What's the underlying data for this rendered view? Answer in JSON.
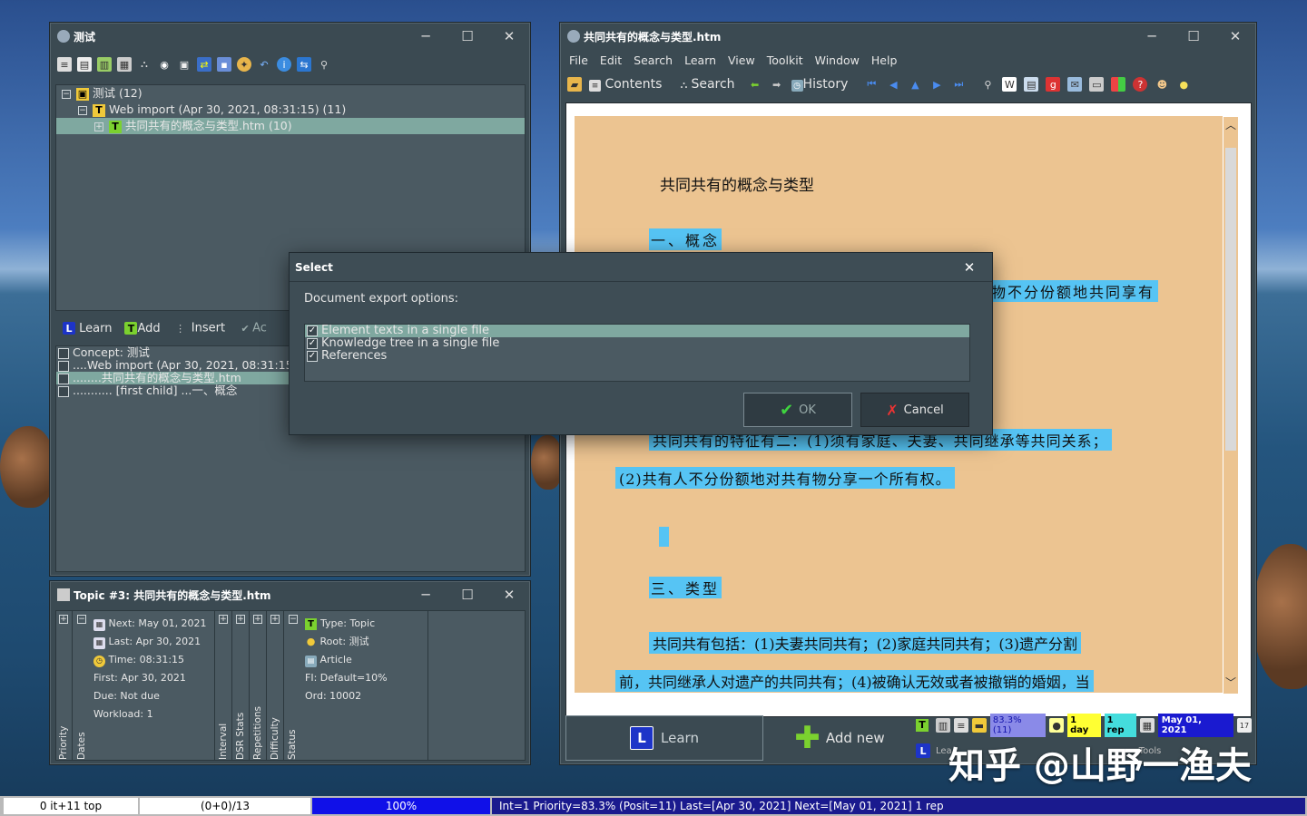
{
  "left_window": {
    "title": "测试",
    "tree": [
      {
        "label": "测试 (12)"
      },
      {
        "label": "Web import (Apr 30, 2021, 08:31:15) (11)"
      },
      {
        "label": "共同共有的概念与类型.htm (10)"
      }
    ],
    "actions": {
      "learn": "Learn",
      "add": "Add",
      "insert": "Insert",
      "accept": "Ac"
    },
    "browser_rows": [
      "Concept: 测试",
      "....Web import (Apr 30, 2021, 08:31:15",
      "........共同共有的概念与类型.htm",
      "........... [first child] ...一、概念"
    ]
  },
  "topic_window": {
    "title": "Topic #3: 共同共有的概念与类型.htm",
    "dates": {
      "next": "Next: May 01, 2021",
      "last": "Last: Apr 30, 2021",
      "time": "Time: 08:31:15",
      "first": "First: Apr 30, 2021",
      "due": "Due: Not due",
      "workload": "Workload: 1"
    },
    "vertical_labels": [
      "Priority",
      "Dates",
      "Interval",
      "DSR Stats",
      "Repetitions",
      "Difficulty",
      "Status"
    ],
    "info": {
      "type": "Type: Topic",
      "root": "Root: 测试",
      "article": "Article",
      "fi": "FI: Default=10%",
      "ord": "Ord: 10002"
    }
  },
  "right_window": {
    "title": "共同共有的概念与类型.htm",
    "menu": [
      "File",
      "Edit",
      "Search",
      "Learn",
      "View",
      "Toolkit",
      "Window",
      "Help"
    ],
    "toolbar": {
      "contents": "Contents",
      "search": "Search",
      "history": "History"
    },
    "doc": {
      "heading": "共同共有的概念与类型",
      "sec1": "一、概念",
      "line1_tail": "物不分份额地共同享有",
      "line2": "共同共有的特征有二：(1)须有家庭、夫妻、共同继承等共同关系；",
      "line3": "(2)共有人不分份额地对共有物分享一个所有权。",
      "sec3": "三、类型",
      "line4": "共同共有包括：(1)夫妻共同共有；(2)家庭共同共有；(3)遗产分割",
      "line5": "前，共同继承人对遗产的共同共有；(4)被确认无效或者被撤销的婚姻，当"
    },
    "bottom": {
      "learn": "Learn",
      "add_new": "Add new",
      "lea": "Lea",
      "tools": "Tools"
    },
    "stats": {
      "priority": "83.3% (11)",
      "interval": "1 day",
      "reps": "1 rep",
      "date": "May 01, 2021"
    }
  },
  "dialog": {
    "title": "Select",
    "prompt": "Document export options:",
    "options": [
      "Element texts in a single file",
      "Knowledge tree in a single file",
      "References"
    ],
    "ok": "OK",
    "cancel": "Cancel"
  },
  "statusbar": {
    "s1": "0 it+11 top",
    "s2": "(0+0)/13",
    "s3": "100%",
    "s4": "Int=1 Priority=83.3% (Posit=11) Last=[Apr 30, 2021] Next=[May 01, 2021] 1 rep"
  },
  "watermark": "知乎 @山野一渔夫"
}
